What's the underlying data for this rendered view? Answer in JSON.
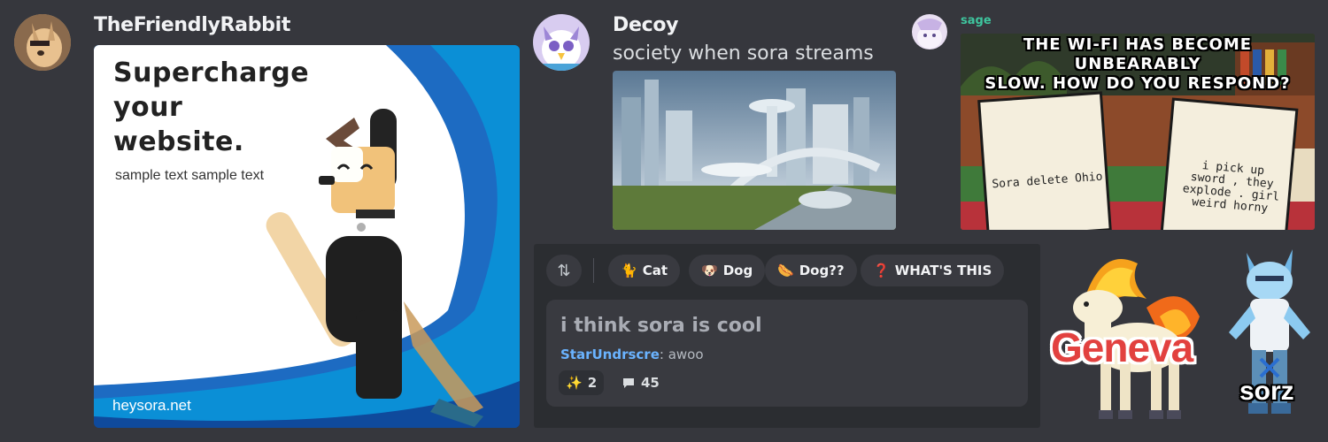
{
  "messages": [
    {
      "username": "TheFriendlyRabbit"
    },
    {
      "username": "Decoy",
      "text": "society when sora streams"
    },
    {
      "username": "sage"
    }
  ],
  "ad": {
    "headline_lines": [
      "Supercharge",
      "your",
      "website."
    ],
    "subtext": "sample text sample text",
    "site": "heysora.net"
  },
  "meme": {
    "caption_lines": [
      "THE WI-FI HAS BECOME UNBEARABLY",
      "SLOW. HOW DO YOU RESPOND?"
    ],
    "left_card": "Sora delete Ohio",
    "right_card_lines": [
      "i pick up",
      "sword , they",
      "explode . girl",
      "weird horny"
    ]
  },
  "forum": {
    "tags": [
      {
        "icon": "cat-icon",
        "emoji": "🐈",
        "label": "Cat"
      },
      {
        "icon": "dog-icon",
        "emoji": "🐶",
        "label": "Dog"
      },
      {
        "icon": "hotdog-icon",
        "emoji": "🌭",
        "label": "Dog??"
      },
      {
        "icon": "question-icon",
        "emoji": "❓",
        "label": "WHAT'S THIS"
      }
    ],
    "post": {
      "title": "i think sora is cool",
      "author": "StarUndrscre",
      "preview": "awoo",
      "reaction_emoji": "✨",
      "reaction_count": "2",
      "reply_count": "45"
    }
  },
  "stickers": {
    "geneva": "Geneva",
    "sorz": "sorz"
  },
  "colors": {
    "background": "#36373d",
    "panel": "#2b2d31",
    "chip": "#393a40",
    "author_link": "#6ab3ff",
    "sage_name": "#3ec59e"
  }
}
